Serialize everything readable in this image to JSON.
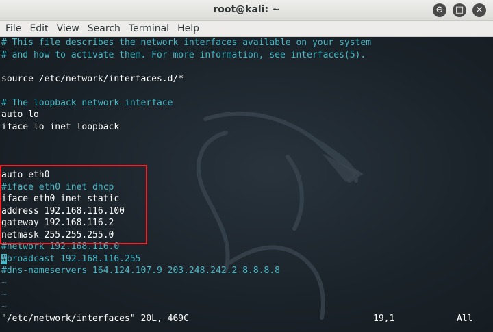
{
  "window": {
    "title": "root@kali: ~",
    "controls": {
      "minimize": "⊖",
      "maximize": "□",
      "close": "×"
    }
  },
  "menu": {
    "items": [
      "File",
      "Edit",
      "View",
      "Search",
      "Terminal",
      "Help"
    ]
  },
  "terminal": {
    "lines": [
      {
        "text": "# This file describes the network interfaces available on your system",
        "style": "comment"
      },
      {
        "text": "# and how to activate them. For more information, see interfaces(5).",
        "style": "comment"
      },
      {
        "text": "",
        "style": "text"
      },
      {
        "text": "source /etc/network/interfaces.d/*",
        "style": "text"
      },
      {
        "text": "",
        "style": "text"
      },
      {
        "text": "# The loopback network interface",
        "style": "comment"
      },
      {
        "text": "auto lo",
        "style": "text"
      },
      {
        "text": "iface lo inet loopback",
        "style": "text"
      },
      {
        "text": "",
        "style": "text"
      },
      {
        "text": "",
        "style": "text"
      },
      {
        "text": "",
        "style": "text"
      },
      {
        "text": "auto eth0",
        "style": "text"
      },
      {
        "text": "#iface eth0 inet dhcp",
        "style": "comment"
      },
      {
        "text": "iface eth0 inet static",
        "style": "text"
      },
      {
        "text": "address 192.168.116.100",
        "style": "text"
      },
      {
        "text": "gateway 192.168.116.2",
        "style": "text"
      },
      {
        "text": "netmask 255.255.255.0",
        "style": "text"
      },
      {
        "text": "#network 192.168.116.0",
        "style": "comment"
      },
      {
        "text": "#broadcast 192.168.116.255",
        "style": "comment",
        "cursor": true
      },
      {
        "text": "#dns-nameservers 164.124.107.9 203.248.242.2 8.8.8.8",
        "style": "comment"
      },
      {
        "text": "~",
        "style": "tilde"
      },
      {
        "text": "~",
        "style": "tilde"
      },
      {
        "text": "~",
        "style": "tilde"
      }
    ],
    "status": {
      "file": "\"/etc/network/interfaces\" 20L, 469C",
      "position": "19,1",
      "scroll": "All"
    }
  },
  "colors": {
    "comment": "#48b9c7",
    "text": "#ffffff",
    "highlight_box": "#e8262b",
    "background": "#1b232a"
  }
}
